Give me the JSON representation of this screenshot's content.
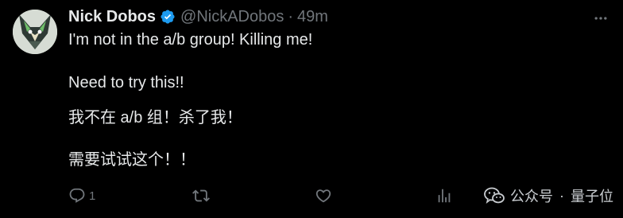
{
  "author": {
    "name": "Nick Dobos",
    "handle": "@NickADobos",
    "separator": "·",
    "time": "49m",
    "verified": true
  },
  "icons": {
    "avatar": "fox-mask-avatar",
    "verified": "verified-badge-icon",
    "more": "more-options-icon",
    "reply": "reply-icon",
    "retweet": "retweet-icon",
    "like": "like-icon",
    "views": "views-icon",
    "wechat": "wechat-icon"
  },
  "tweet": {
    "lines": [
      "I'm not in the a/b group! Killing me!",
      "Need to try this!!",
      "我不在 a/b 组！杀了我！",
      "需要试试这个！！"
    ]
  },
  "actions": {
    "reply_count": "1",
    "retweet_count": "",
    "like_count": "",
    "views_count": ""
  },
  "watermark": {
    "platform": "公众号",
    "separator": "·",
    "brand": "量子位"
  },
  "colors": {
    "background": "#000000",
    "text": "#e7e9ea",
    "muted": "#71767b",
    "verified": "#1d9bf0"
  }
}
